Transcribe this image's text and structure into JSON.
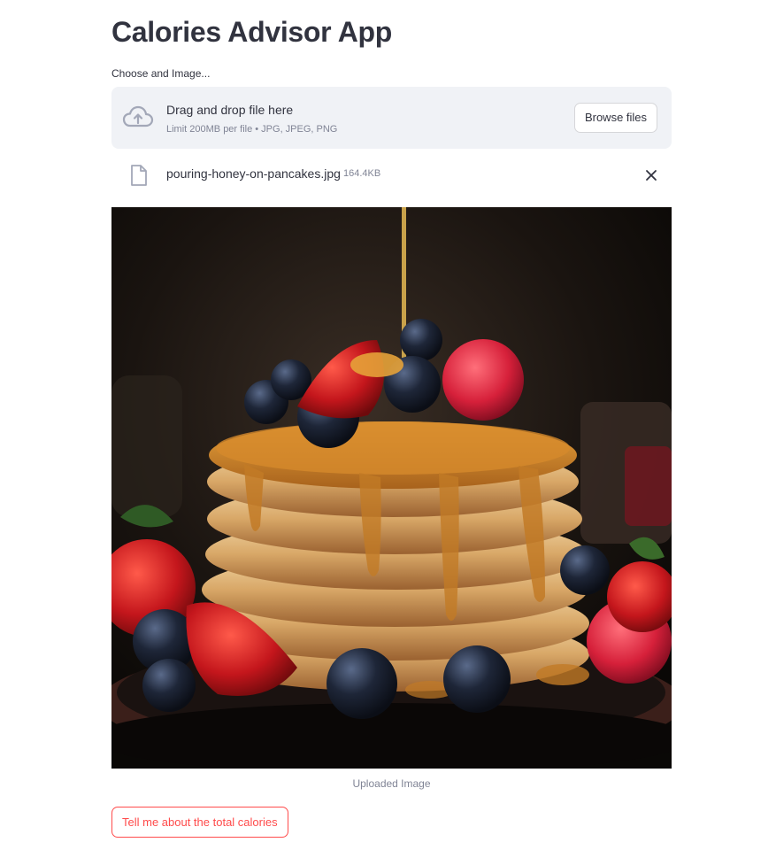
{
  "app": {
    "title": "Calories Advisor App"
  },
  "uploader": {
    "label": "Choose and Image...",
    "drop_text": "Drag and drop file here",
    "limit_text": "Limit 200MB per file • JPG, JPEG, PNG",
    "browse_label": "Browse files",
    "icon": "cloud-upload-icon"
  },
  "uploaded_file": {
    "name": "pouring-honey-on-pancakes.jpg",
    "size": "164.4KB",
    "icon": "file-icon",
    "remove_icon": "close-icon"
  },
  "image": {
    "caption": "Uploaded Image"
  },
  "action": {
    "label": "Tell me about the total calories"
  },
  "colors": {
    "accent": "#ff4b4b",
    "text": "#31333f",
    "muted": "#808495",
    "dropzone_bg": "#f0f2f6"
  }
}
